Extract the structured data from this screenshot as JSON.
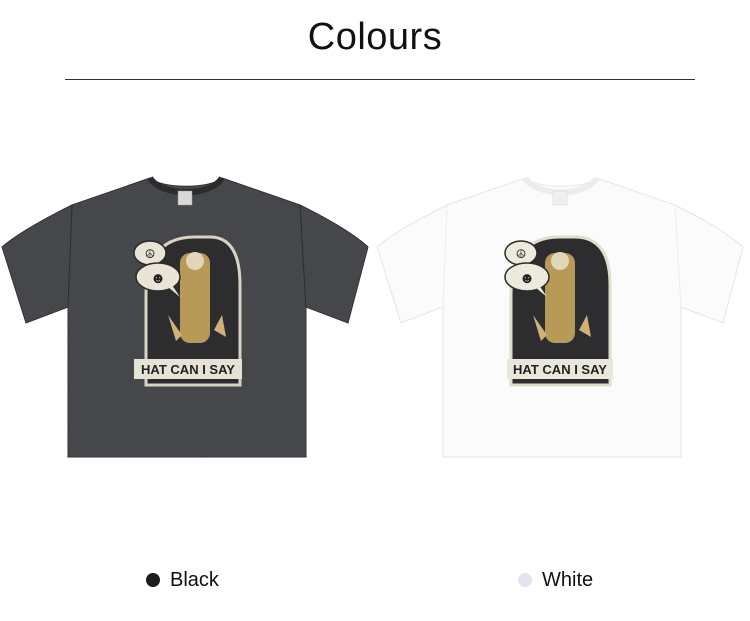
{
  "header": {
    "title": "Colours"
  },
  "products": [
    {
      "color_name": "Black",
      "swatch_color": "#1c1c1c",
      "shirt_color": "#3b3d40",
      "graphic_caption": "HAT CAN I SAY",
      "icon": "tshirt-icon"
    },
    {
      "color_name": "White",
      "swatch_color": "#e3e4f2",
      "shirt_color": "#fbfbfb",
      "graphic_caption": "HAT CAN I SAY",
      "icon": "tshirt-icon"
    }
  ]
}
